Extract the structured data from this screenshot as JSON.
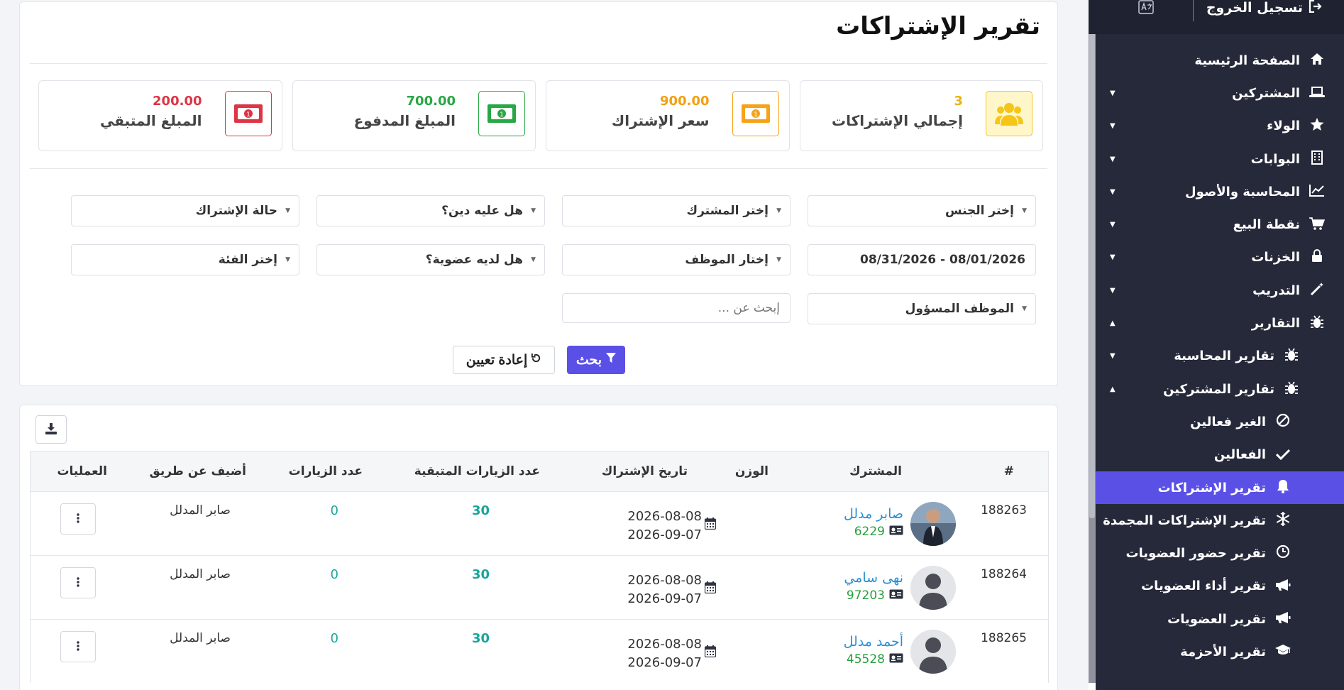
{
  "sidebar": {
    "logout_label": "تسجيل الخروج",
    "items": [
      {
        "label": "الصفحة الرئيسية",
        "icon": "home-icon"
      },
      {
        "label": "المشتركين",
        "icon": "laptop-icon"
      },
      {
        "label": "الولاء",
        "icon": "star-icon"
      },
      {
        "label": "البوابات",
        "icon": "building-icon"
      },
      {
        "label": "المحاسبة والأصول",
        "icon": "chart-line-icon"
      },
      {
        "label": "نقطة البيع",
        "icon": "cart-icon"
      },
      {
        "label": "الخزنات",
        "icon": "lock-icon"
      },
      {
        "label": "التدريب",
        "icon": "magic-wand-icon"
      },
      {
        "label": "التقارير",
        "icon": "bug-icon"
      },
      {
        "label": "تقارير المحاسبة",
        "icon": "bug-icon"
      },
      {
        "label": "تقارير المشتركين",
        "icon": "bug-icon"
      },
      {
        "label": "الغير فعالين",
        "icon": "ban-icon"
      },
      {
        "label": "الفعالين",
        "icon": "check-icon"
      },
      {
        "label": "تقرير الإشتراكات",
        "icon": "bell-icon"
      },
      {
        "label": "تقرير الإشتراكات المجمدة",
        "icon": "snowflake-icon"
      },
      {
        "label": "تقرير حضور العضويات",
        "icon": "clock-icon"
      },
      {
        "label": "تقرير أداء العضويات",
        "icon": "megaphone-icon"
      },
      {
        "label": "تقرير العضويات",
        "icon": "megaphone-icon"
      },
      {
        "label": "تقرير الأحزمة",
        "icon": "graduation-cap-icon"
      }
    ]
  },
  "page": {
    "title": "تقرير الإشتراكات"
  },
  "stats": [
    {
      "value": "3",
      "label": "إجمالي الإشتراكات",
      "color": "#f5c518",
      "icon": "users-icon"
    },
    {
      "value": "900.00",
      "label": "سعر الإشتراك",
      "color": "#f5a318",
      "icon": "money-icon"
    },
    {
      "value": "700.00",
      "label": "المبلغ المدفوع",
      "color": "#28a745",
      "icon": "money-icon"
    },
    {
      "value": "200.00",
      "label": "المبلغ المتبقي",
      "color": "#dc3545",
      "icon": "money-icon"
    }
  ],
  "filters": {
    "gender": "إختر الجنس",
    "subscriber": "إختر المشترك",
    "debt": "هل عليه دين؟",
    "status": "حالة الإشتراك",
    "date_range": "08/31/2026 - 08/01/2026",
    "employee": "إختار الموظف",
    "membership": "هل لديه عضوية؟",
    "category": "إختر الفئة",
    "responsible": "الموظف المسؤول",
    "search_placeholder": "إبحث عن ..."
  },
  "buttons": {
    "search": "بحث",
    "reset": "إعادة تعيين"
  },
  "table": {
    "headers": {
      "id": "#",
      "subscriber": "المشترك",
      "weight": "الوزن",
      "date": "تاريخ الإشتراك",
      "remaining": "عدد الزيارات المتبقية",
      "visits": "عدد الزيارات",
      "added_by": "أضيف عن طريق",
      "actions": "العمليات"
    },
    "rows": [
      {
        "id": "188263",
        "name": "صابر مدلل",
        "code": "6229",
        "start": "2026-08-08",
        "end": "2026-09-07",
        "remaining": "30",
        "visits": "0",
        "added_by": "صابر المدلل",
        "photo": "photo"
      },
      {
        "id": "188264",
        "name": "نهى سامي",
        "code": "97203",
        "start": "2026-08-08",
        "end": "2026-09-07",
        "remaining": "30",
        "visits": "0",
        "added_by": "صابر المدلل",
        "photo": "placeholder"
      },
      {
        "id": "188265",
        "name": "أحمد مدلل",
        "code": "45528",
        "start": "2026-08-08",
        "end": "2026-09-07",
        "remaining": "30",
        "visits": "0",
        "added_by": "صابر المدلل",
        "photo": "placeholder"
      }
    ]
  }
}
